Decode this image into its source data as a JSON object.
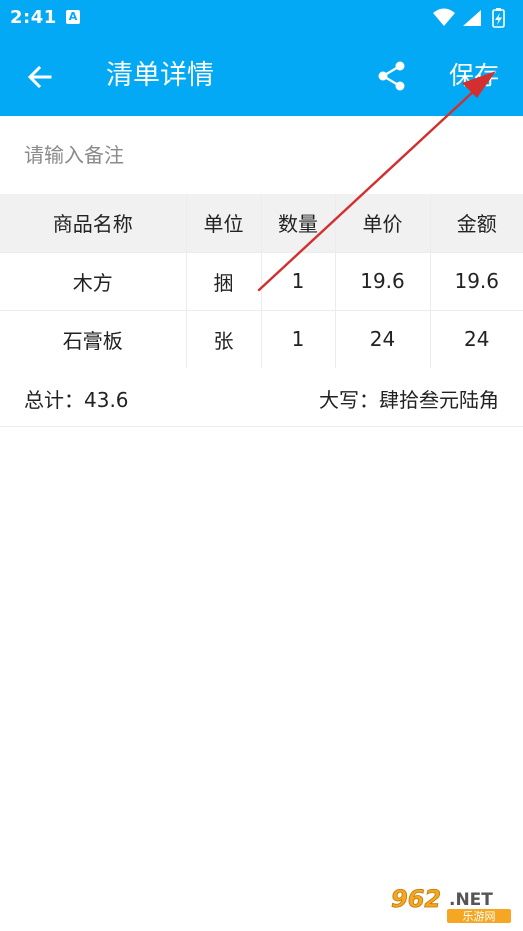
{
  "status_bar": {
    "time": "2:41",
    "notification_icon": "A"
  },
  "app_bar": {
    "title": "清单详情",
    "save_label": "保存",
    "background_color": "#03A9F4"
  },
  "remark": {
    "placeholder": "请输入备注",
    "value": ""
  },
  "table": {
    "headers": [
      "商品名称",
      "单位",
      "数量",
      "单价",
      "金额"
    ],
    "rows": [
      [
        "木方",
        "捆",
        "1",
        "19.6",
        "19.6"
      ],
      [
        "石膏板",
        "张",
        "1",
        "24",
        "24"
      ]
    ]
  },
  "summary": {
    "total": "总计：43.6",
    "uppercase_amount": "大写：肆拾叁元陆角"
  },
  "watermark": {
    "logo_text": "962",
    "suffix": ".NET",
    "subtitle": "乐游网"
  },
  "annotation": {
    "arrow_color": "#D32F2F"
  }
}
